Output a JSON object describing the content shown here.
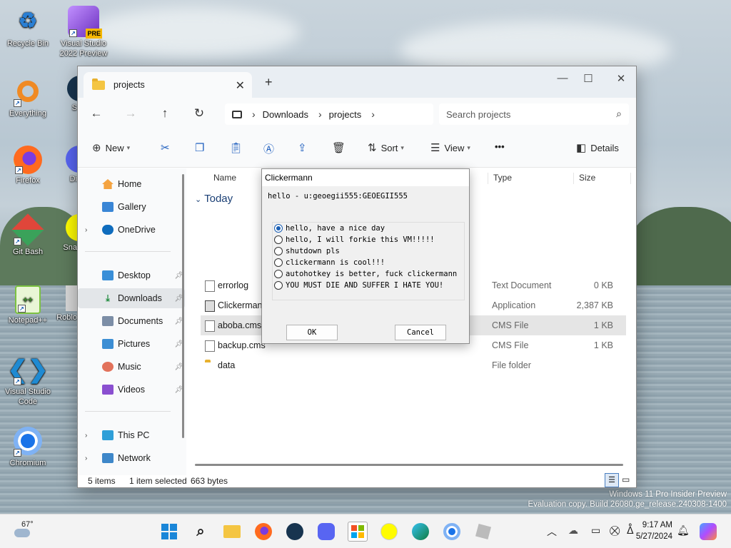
{
  "desktop": {
    "icons": [
      {
        "label_lines": [
          "Recycle Bin"
        ],
        "icon": "recycle-bin-icon"
      },
      {
        "label_lines": [
          "Visual Studio",
          "2022 Preview"
        ],
        "icon": "visual-studio-icon",
        "badge": "PRE"
      },
      {
        "label_lines": [
          "Everything"
        ],
        "icon": "everything-search-icon"
      },
      {
        "label_lines": [
          "S"
        ],
        "icon": "steam-icon"
      },
      {
        "label_lines": [
          "Firefox"
        ],
        "icon": "firefox-icon"
      },
      {
        "label_lines": [
          "Di"
        ],
        "icon": "discord-icon"
      },
      {
        "label_lines": [
          "Git Bash"
        ],
        "icon": "git-bash-icon"
      },
      {
        "label_lines": [
          "Sna"
        ],
        "icon": "snapchat-icon"
      },
      {
        "label_lines": [
          "Notepad++"
        ],
        "icon": "notepad-plus-plus-icon"
      },
      {
        "label_lines": [
          "Roblo"
        ],
        "icon": "roblox-icon"
      },
      {
        "label_lines": [
          "Visual Studio",
          "Code"
        ],
        "icon": "vscode-icon"
      },
      {
        "label_lines": [
          "Chromium"
        ],
        "icon": "chromium-icon"
      }
    ],
    "watermark": {
      "line1": "Windows 11 Pro Insider Preview",
      "line2": "Evaluation copy. Build 26080.ge_release.240308-1400"
    }
  },
  "explorer": {
    "tab_title": "projects",
    "new_tab": "+",
    "address": {
      "crumbs": [
        "Downloads",
        "projects"
      ]
    },
    "search_placeholder": "Search projects",
    "toolbar": {
      "new": "New",
      "sort": "Sort",
      "view": "View",
      "more": "•••",
      "details": "Details"
    },
    "sidebar": {
      "home": "Home",
      "gallery": "Gallery",
      "onedrive": "OneDrive",
      "quick": [
        {
          "label": "Desktop",
          "icon": "desktop-icon"
        },
        {
          "label": "Downloads",
          "icon": "downloads-icon",
          "selected": true
        },
        {
          "label": "Documents",
          "icon": "documents-icon"
        },
        {
          "label": "Pictures",
          "icon": "pictures-icon"
        },
        {
          "label": "Music",
          "icon": "music-icon"
        },
        {
          "label": "Videos",
          "icon": "videos-icon"
        }
      ],
      "this_pc": "This PC",
      "network": "Network"
    },
    "columns": {
      "name": "Name",
      "type": "Type",
      "size": "Size"
    },
    "group": "Today",
    "files": [
      {
        "name": "errorlog",
        "type": "Text Document",
        "size": "0 KB",
        "selected": false
      },
      {
        "name": "Clickermann",
        "type": "Application",
        "size": "2,387 KB",
        "selected": false
      },
      {
        "name": "aboba.cms",
        "type": "CMS File",
        "size": "1 KB",
        "selected": true
      },
      {
        "name": "backup.cms",
        "type": "CMS File",
        "size": "1 KB",
        "selected": false
      },
      {
        "name": "data",
        "type": "File folder",
        "size": "",
        "selected": false
      }
    ],
    "status": {
      "items": "5 items",
      "selection": "1 item selected",
      "bytes": "663 bytes"
    }
  },
  "dialog": {
    "title": "Clickermann",
    "prompt": "hello - u:geoegii555:GEOEGII555",
    "options": [
      "hello, have a nice day",
      "hello, I will forkie this VM!!!!!",
      "shutdown pls",
      "clickermann is cool!!!",
      "autohotkey is better, fuck clickermann",
      "YOU MUST DIE AND SUFFER I HATE YOU!"
    ],
    "selected_index": 0,
    "ok": "OK",
    "cancel": "Cancel"
  },
  "taskbar": {
    "weather_temp": "67°",
    "time": "9:17 AM",
    "date": "5/27/2024",
    "pinned": [
      "start-icon",
      "search-icon",
      "file-explorer-icon",
      "firefox-icon",
      "steam-icon",
      "discord-icon",
      "microsoft-store-icon",
      "snapchat-icon",
      "edge-icon",
      "chromium-icon",
      "roblox-icon"
    ]
  }
}
